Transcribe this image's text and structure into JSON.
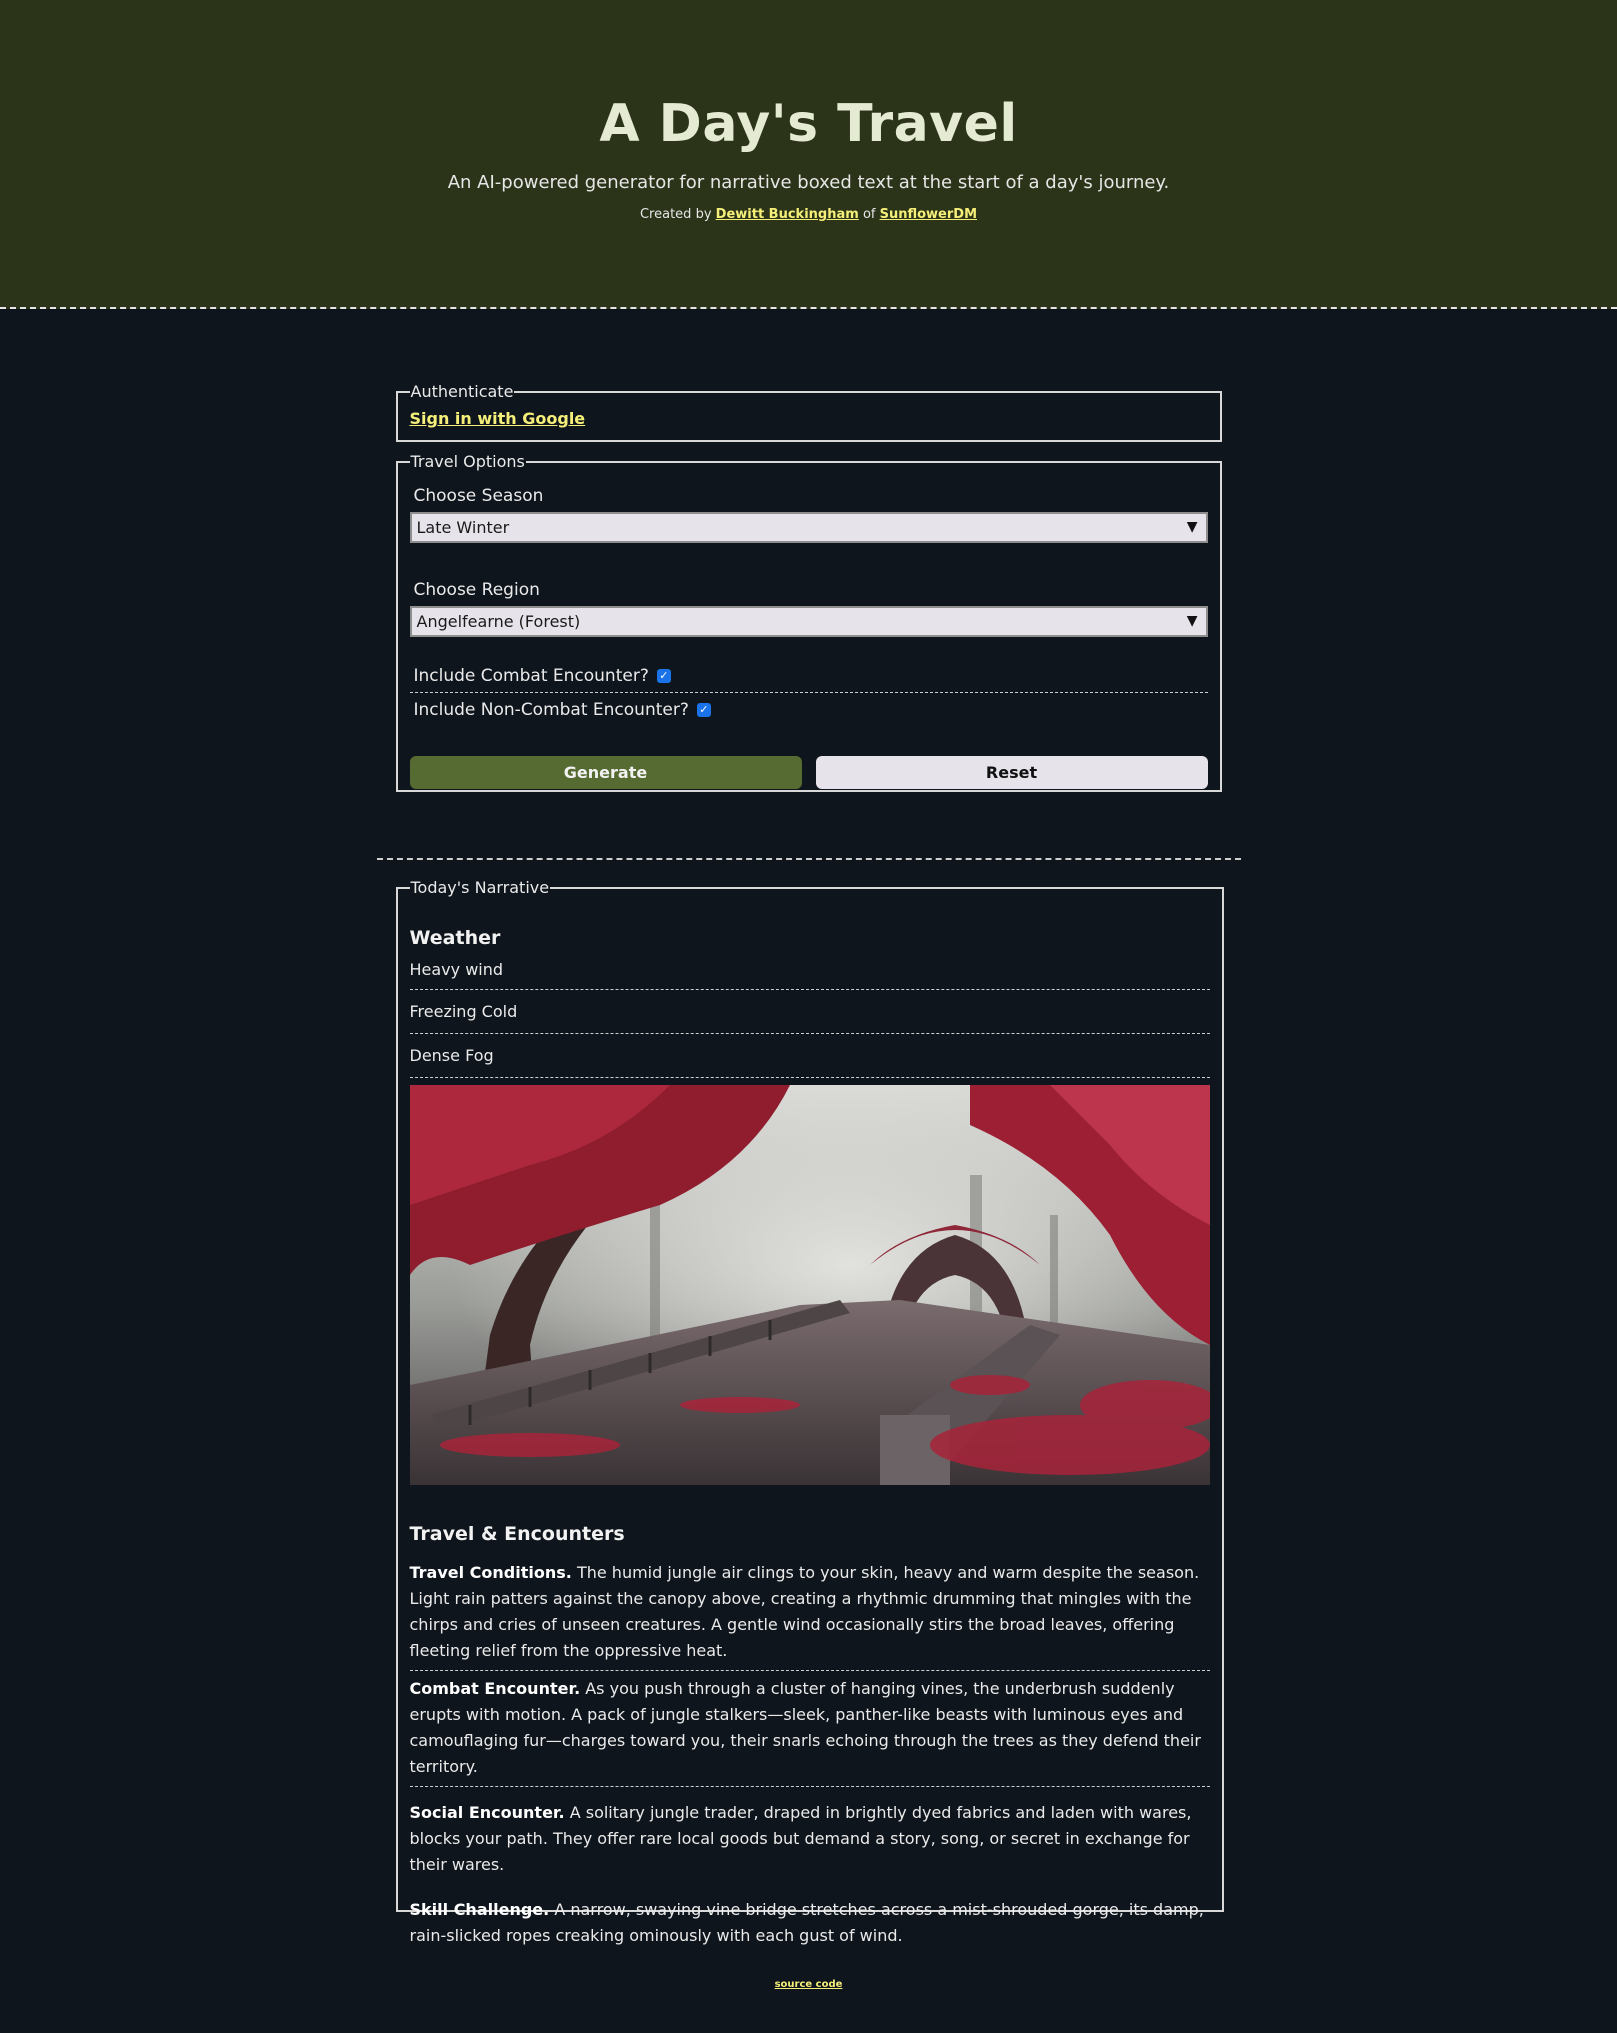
{
  "header": {
    "title": "A Day's Travel",
    "tagline": "An AI-powered generator for narrative boxed text at the start of a day's journey.",
    "credits_prefix": "Created by",
    "author": "Dewitt Buckingham",
    "credits_middle": "of",
    "org": "SunflowerDM"
  },
  "auth": {
    "legend": "Authenticate",
    "sign_in": "Sign in with Google"
  },
  "options": {
    "legend": "Travel Options",
    "season_label": "Choose Season",
    "season_value": "Late Winter",
    "region_label": "Choose Region",
    "region_value": "Angelfearne (Forest)",
    "combat_label": "Include Combat Encounter?",
    "combat_checked": true,
    "noncombat_label": "Include Non-Combat Encounter?",
    "noncombat_checked": true,
    "generate": "Generate",
    "reset": "Reset"
  },
  "narrative": {
    "legend": "Today's Narrative",
    "weather_heading": "Weather",
    "weather": [
      "Heavy wind",
      "Freezing Cold",
      "Dense Fog"
    ],
    "travel_heading": "Travel & Encounters",
    "entries": [
      {
        "label": "Travel Conditions.",
        "text": "The humid jungle air clings to your skin, heavy and warm despite the season. Light rain patters against the canopy above, creating a rhythmic drumming that mingles with the chirps and cries of unseen creatures. A gentle wind occasionally stirs the broad leaves, offering fleeting relief from the oppressive heat."
      },
      {
        "label": "Combat Encounter.",
        "text": "As you push through a cluster of hanging vines, the underbrush suddenly erupts with motion. A pack of jungle stalkers—sleek, panther-like beasts with luminous eyes and camouflaging fur—charges toward you, their snarls echoing through the trees as they defend their territory."
      },
      {
        "label": "Social Encounter.",
        "text": "A solitary jungle trader, draped in brightly dyed fabrics and laden with wares, blocks your path. They offer rare local goods but demand a story, song, or secret in exchange for their wares."
      },
      {
        "label": "Skill Challenge.",
        "text": "A narrow, swaying vine bridge stretches across a mist-shrouded gorge, its damp, rain-slicked ropes creaking ominously with each gust of wind."
      }
    ]
  },
  "footer": {
    "source": "source code"
  },
  "icons": {
    "dropdown": "triangle-down-icon",
    "checkbox": "checkmark-icon"
  },
  "colors": {
    "header_bg": "#2b3418",
    "page_bg": "#0f151c",
    "link": "#f5ef7a",
    "generate_bg": "#566b31"
  }
}
